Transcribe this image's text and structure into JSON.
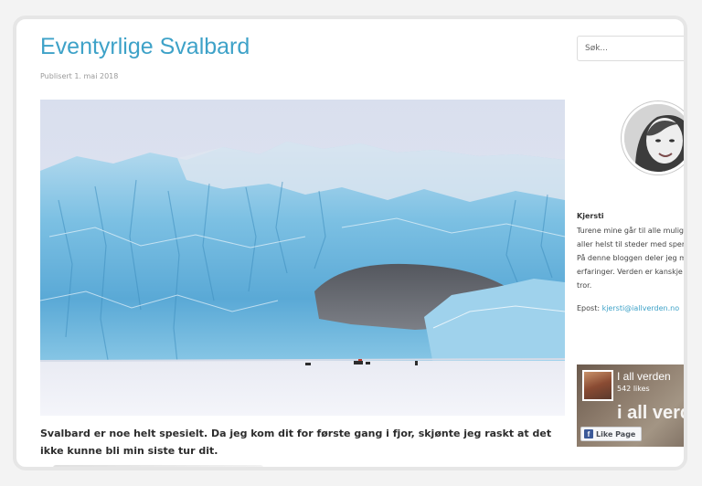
{
  "post": {
    "title": "Eventyrlige Svalbard",
    "meta": "Publisert 1. mai 2018",
    "intro": "Svalbard er noe helt spesielt. Da jeg kom dit for første gang i fjor, skjønte jeg raskt at det ikke kunne bli min siste tur dit."
  },
  "sidebar": {
    "search_placeholder": "Søk...",
    "author": "Kjersti",
    "bio_lines": [
      "Turene mine går til alle mulig",
      "aller helst til steder med sper",
      "På denne bloggen deler jeg m",
      "erfaringer. Verden er kanskje",
      "tror."
    ],
    "contact_label": "Epost:",
    "contact_email": "kjersti@iallverden.no",
    "facebook": {
      "page_name": "I all verden",
      "likes": "542 likes",
      "cover_text": "i all verde",
      "like_button": "Like Page",
      "icon": "facebook-icon"
    }
  },
  "colors": {
    "accent": "#3ea2c8",
    "glacier": "#6fb8de"
  }
}
